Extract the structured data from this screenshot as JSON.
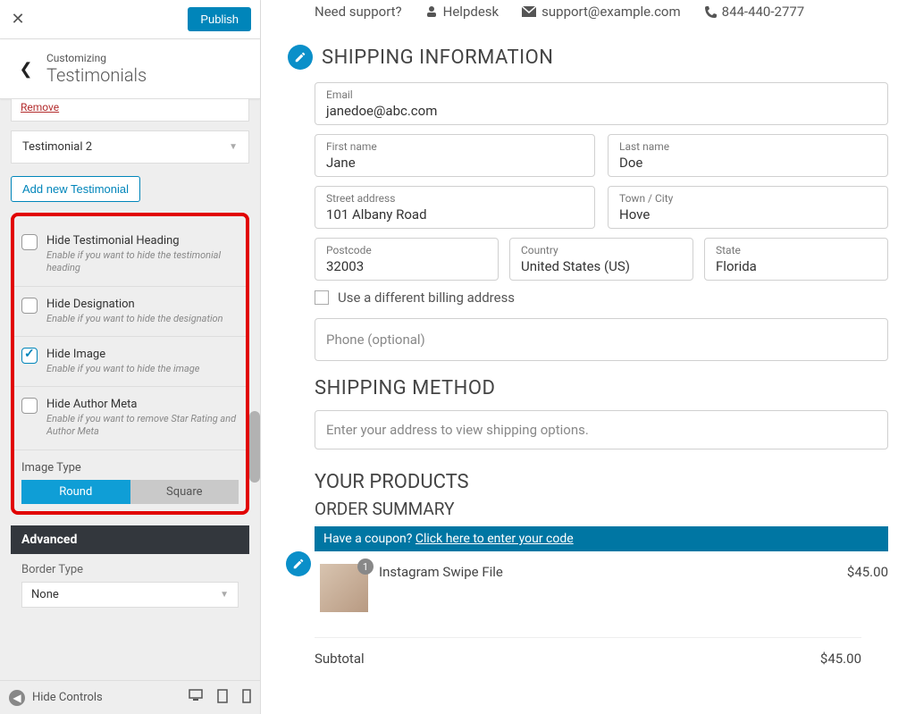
{
  "sidebar": {
    "publish_label": "Publish",
    "customizing_label": "Customizing",
    "section_title": "Testimonials",
    "remove_label": "Remove",
    "testimonial_dropdown": "Testimonial 2",
    "add_new_label": "Add new Testimonial",
    "options": [
      {
        "label": "Hide Testimonial Heading",
        "desc": "Enable if you want to hide the testimonial heading",
        "checked": false
      },
      {
        "label": "Hide Designation",
        "desc": "Enable if you want to hide the designation",
        "checked": false
      },
      {
        "label": "Hide Image",
        "desc": "Enable if you want to hide the image",
        "checked": true
      },
      {
        "label": "Hide Author Meta",
        "desc": "Enable if you want to remove Star Rating and Author Meta",
        "checked": false
      }
    ],
    "image_type_label": "Image Type",
    "image_type_round": "Round",
    "image_type_square": "Square",
    "advanced_label": "Advanced",
    "border_type_label": "Border Type",
    "border_type_value": "None",
    "hide_controls_label": "Hide Controls"
  },
  "support": {
    "need_label": "Need support?",
    "helpdesk": "Helpdesk",
    "email": "support@example.com",
    "phone": "844-440-2777"
  },
  "shipping": {
    "heading": "SHIPPING INFORMATION",
    "email_label": "Email",
    "email_value": "janedoe@abc.com",
    "first_label": "First name",
    "first_value": "Jane",
    "last_label": "Last name",
    "last_value": "Doe",
    "street_label": "Street address",
    "street_value": "101 Albany Road",
    "town_label": "Town / City",
    "town_value": "Hove",
    "postcode_label": "Postcode",
    "postcode_value": "32003",
    "country_label": "Country",
    "country_value": "United States (US)",
    "state_label": "State",
    "state_value": "Florida",
    "diff_billing_label": "Use a different billing address",
    "phone_placeholder": "Phone (optional)"
  },
  "shipping_method": {
    "heading": "SHIPPING METHOD",
    "placeholder": "Enter your address to view shipping options."
  },
  "products": {
    "heading": "YOUR PRODUCTS",
    "summary_heading": "ORDER SUMMARY",
    "coupon_text1": "Have a coupon? ",
    "coupon_link": "Click here to enter your code",
    "item_name": "Instagram Swipe File",
    "item_qty": "1",
    "item_price": "$45.00",
    "subtotal_label": "Subtotal",
    "subtotal_value": "$45.00"
  }
}
